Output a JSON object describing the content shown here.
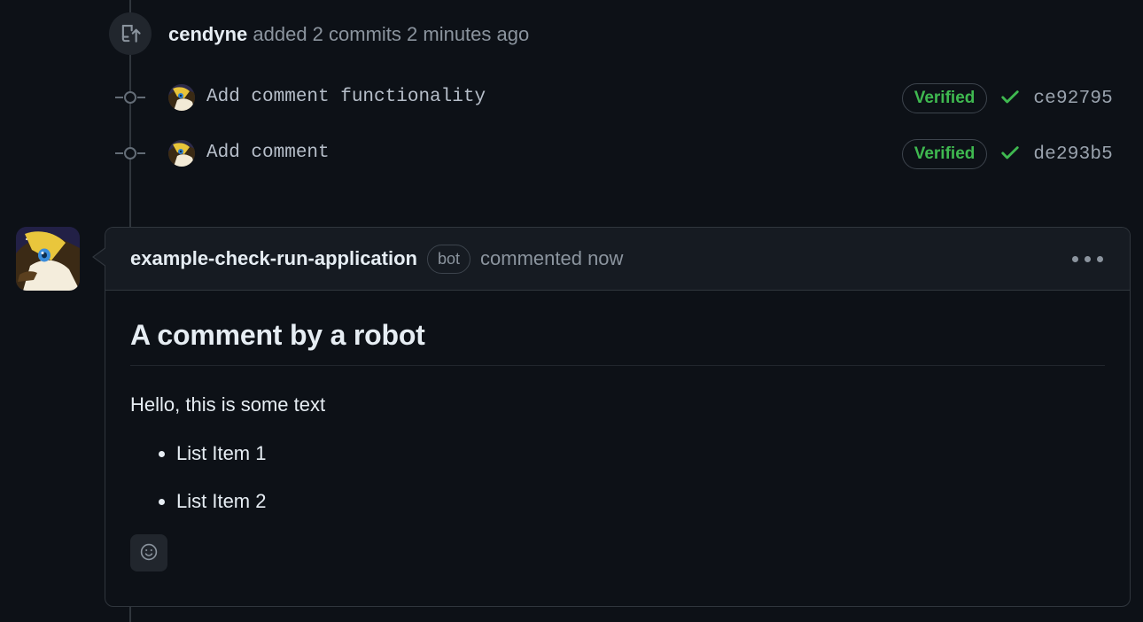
{
  "theme": {
    "page_background": "#0d1117",
    "card_header_background": "#161b22",
    "border": "#30363d",
    "text_primary": "#e6edf3",
    "text_muted": "#8b949e",
    "accent_green": "#3fb950",
    "timeline_line": "#30363d"
  },
  "push_event": {
    "icon": "repo-push-icon",
    "actor": "cendyne",
    "description": "added 2 commits 2 minutes ago"
  },
  "commits": [
    {
      "avatar": "user-avatar",
      "message": "Add comment functionality",
      "verified_label": "Verified",
      "check_icon": "check-icon",
      "sha": "ce92795"
    },
    {
      "avatar": "user-avatar",
      "message": "Add comment",
      "verified_label": "Verified",
      "check_icon": "check-icon",
      "sha": "de293b5"
    }
  ],
  "comment": {
    "avatar": "bot-avatar",
    "author": "example-check-run-application",
    "badge": "bot",
    "action": "commented now",
    "menu_icon": "kebab-menu-icon",
    "title": "A comment by a robot",
    "paragraph": "Hello, this is some text",
    "list_items": [
      "List Item 1",
      "List Item 2"
    ],
    "reaction_icon": "smiley-icon"
  }
}
